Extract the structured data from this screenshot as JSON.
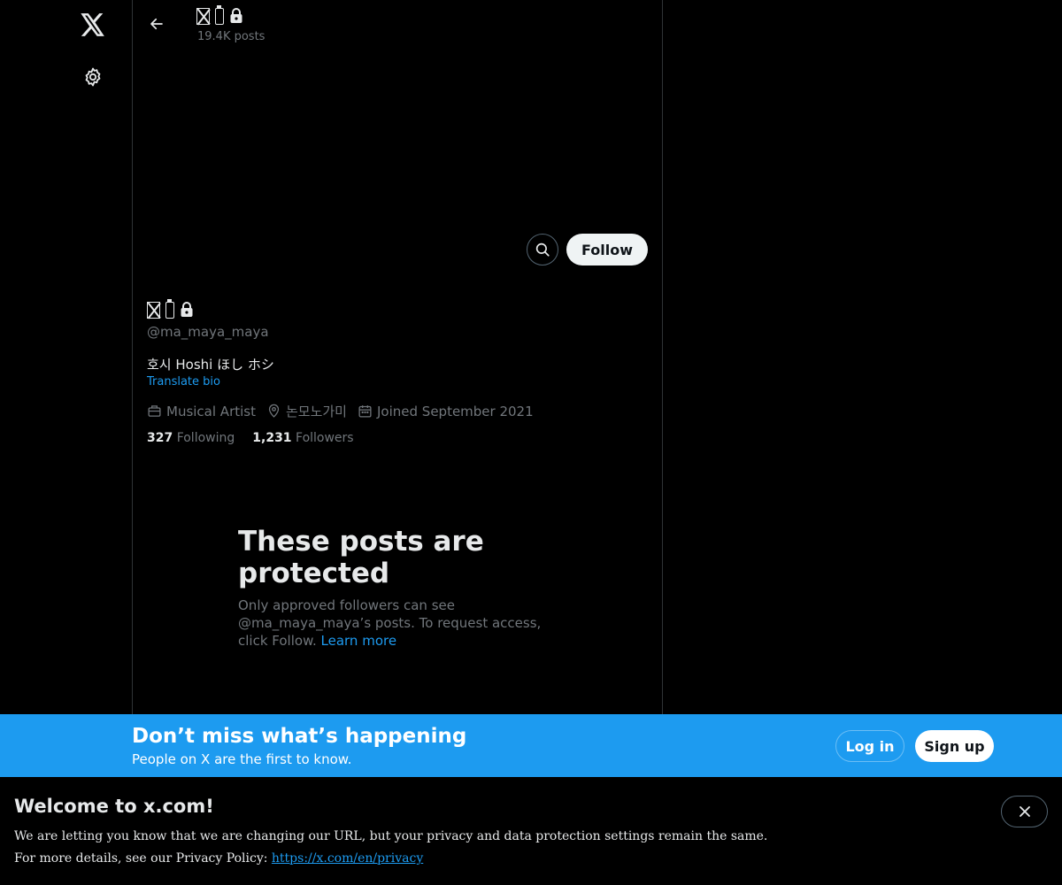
{
  "nav": {
    "logo_icon": "x-logo-icon",
    "settings_icon": "gear-icon"
  },
  "header": {
    "back_icon": "arrow-left-icon",
    "posts_count": "19.4K posts"
  },
  "profile": {
    "handle": "@ma_maya_maya",
    "bio": "호시 Hoshi ほし ホシ",
    "translate_bio": "Translate bio",
    "category": "Musical Artist",
    "location": "논모노가미",
    "joined": "Joined September 2021",
    "following_count": "327",
    "following_label": "Following",
    "followers_count": "1,231",
    "followers_label": "Followers",
    "follow_label": "Follow"
  },
  "protected": {
    "title": "These posts are protected",
    "text": "Only approved followers can see @ma_maya_maya’s posts. To request access, click Follow.",
    "learn_more": "Learn more"
  },
  "banner": {
    "title": "Don’t miss what’s happening",
    "subtitle": "People on X are the first to know.",
    "login_label": "Log in",
    "signup_label": "Sign up",
    "color": "#1d9bf0"
  },
  "notice": {
    "title": "Welcome to x.com!",
    "line1": "We are letting you know that we are changing our URL, but your privacy and data protection settings remain the same.",
    "line2_prefix": "For more details, see our Privacy Policy:",
    "privacy_link": "https://x.com/en/privacy"
  }
}
